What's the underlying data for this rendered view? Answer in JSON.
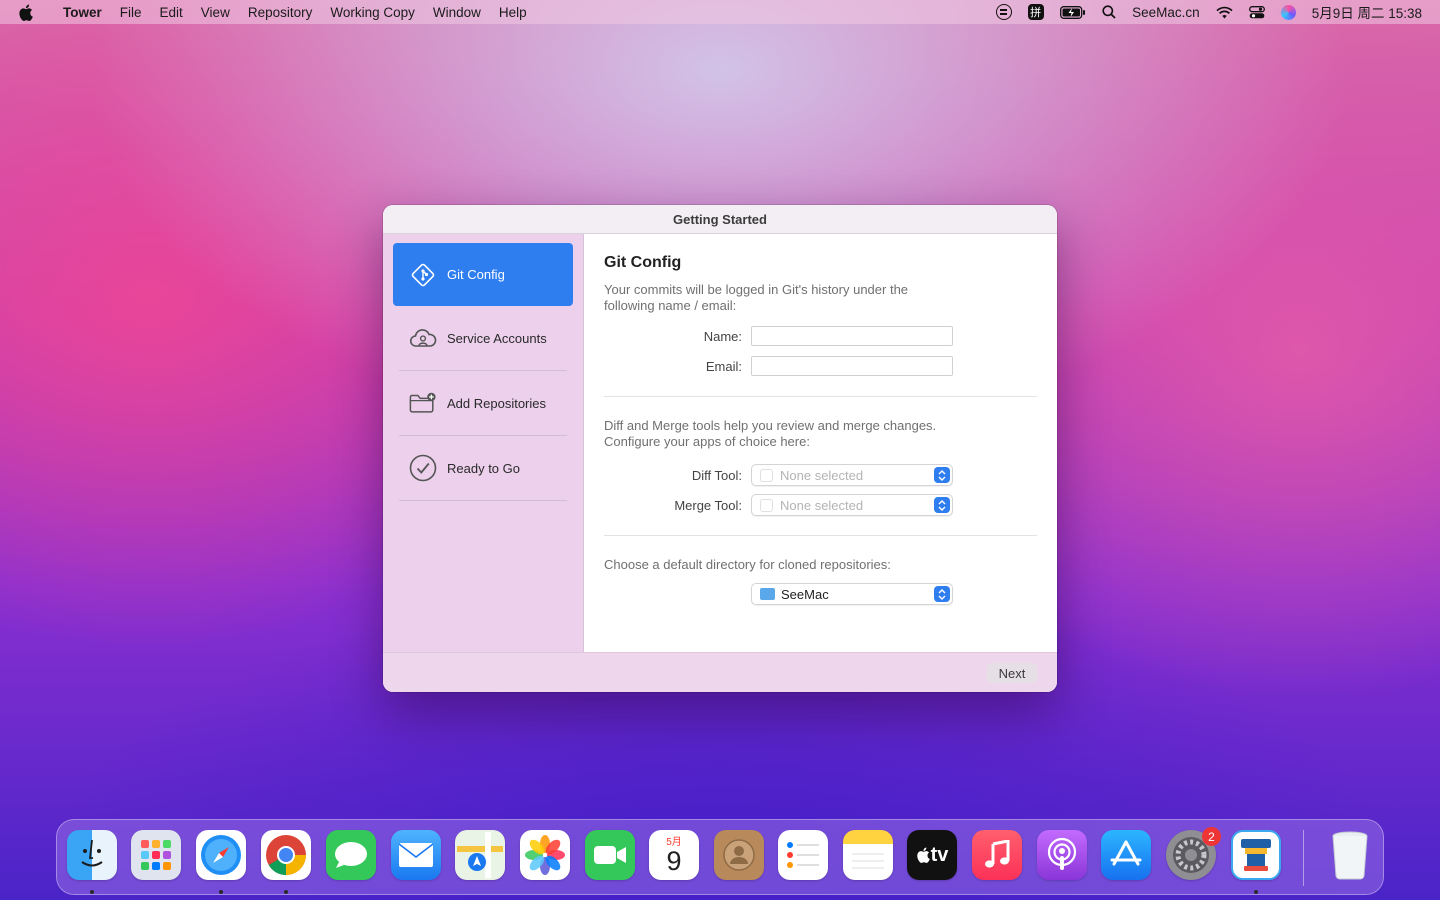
{
  "menubar": {
    "app_name": "Tower",
    "menus": [
      "File",
      "Edit",
      "View",
      "Repository",
      "Working Copy",
      "Window",
      "Help"
    ],
    "site": "SeeMac.cn",
    "clock": "5月9日 周二  15:38"
  },
  "window": {
    "title": "Getting Started",
    "sidebar": {
      "items": [
        {
          "label": "Git Config",
          "icon": "git-diamond-icon",
          "active": true
        },
        {
          "label": "Service Accounts",
          "icon": "cloud-user-icon",
          "active": false
        },
        {
          "label": "Add Repositories",
          "icon": "folder-add-icon",
          "active": false
        },
        {
          "label": "Ready to Go",
          "icon": "checkmark-circle-icon",
          "active": false
        }
      ]
    },
    "content": {
      "heading": "Git Config",
      "identity_desc": "Your commits will be logged in Git's history under the following name / email:",
      "name_label": "Name:",
      "name_value": "",
      "email_label": "Email:",
      "email_value": "",
      "tools_desc": "Diff and Merge tools help you review and merge changes. Configure your apps of choice here:",
      "diff_label": "Diff Tool:",
      "diff_value": "None selected",
      "merge_label": "Merge Tool:",
      "merge_value": "None selected",
      "dir_desc": "Choose a default directory for cloned repositories:",
      "dir_value": "SeeMac"
    },
    "next_label": "Next"
  },
  "dock": {
    "calendar_month": "5月",
    "calendar_day": "9",
    "settings_badge": "2",
    "tv_label": "tv"
  },
  "colors": {
    "accent": "#2f7ef0",
    "sidebar_bg": "#ecd0ec"
  }
}
